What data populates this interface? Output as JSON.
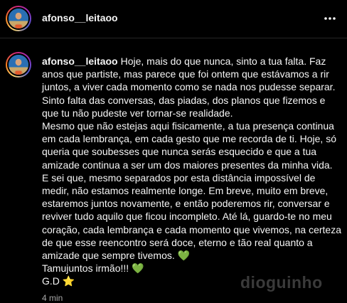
{
  "header": {
    "username": "afonso__leitaoo",
    "more_icon": "more-horizontal-icon"
  },
  "comment": {
    "username": "afonso__leitaoo",
    "text": "Hoje, mais do que nunca, sinto a tua falta. Faz anos que partiste, mas parece que foi ontem que estávamos a rir juntos, a viver cada momento como se nada nos pudesse separar. Sinto falta das conversas, das piadas, dos planos que fizemos e que tu não pudeste ver tornar-se realidade.\nMesmo que não estejas aqui fisicamente, a tua presença continua em cada lembrança, em cada gesto que me recorda de ti. Hoje, só queria que soubesses que nunca serás esquecido e que a tua amizade continua a ser um dos maiores presentes da minha vida.\nE sei que, mesmo separados por esta distância impossível de medir, não estamos realmente longe. Em breve, muito em breve, estaremos juntos novamente, e então poderemos rir, conversar e reviver tudo aquilo que ficou incompleto. Até lá, guardo-te no meu coração, cada lembrança e cada momento que vivemos, na certeza de que esse reencontro será doce, eterno e tão real quanto a amizade que sempre tivemos. 💚\nTamujuntos irmão!!! 💚\nG.D ⭐",
    "timestamp": "4 min"
  },
  "watermark": "dioguinho",
  "colors": {
    "background": "#000000",
    "text": "#f5f5f5",
    "secondary_text": "#a8a8a8",
    "divider": "#262626"
  }
}
